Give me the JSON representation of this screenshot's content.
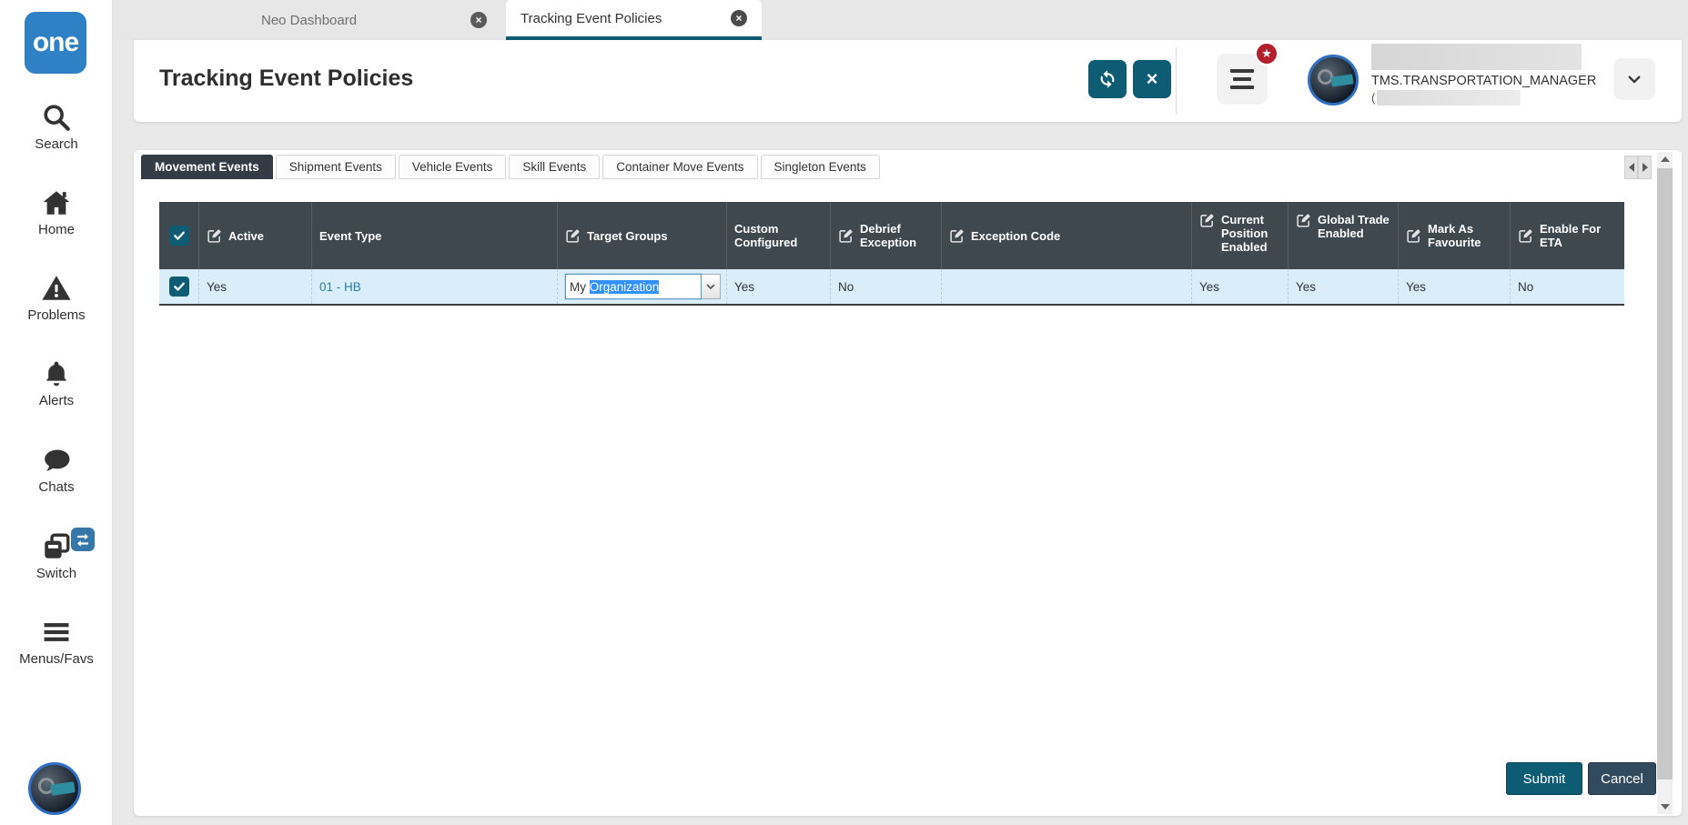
{
  "colors": {
    "teal": "#0d5c74",
    "grid_header": "#3f474f",
    "active_view_tab": "#333b44",
    "row_bg": "#daeef9",
    "link": "#2d7fa3",
    "logo_blue": "#2e81c4",
    "selection_blue": "#3390ff",
    "badge_red": "#b1202c",
    "cancel_btn": "#324a5e"
  },
  "icons": {
    "close_glyph": "×",
    "star_glyph": "★"
  },
  "sidebar": {
    "logo": "one",
    "items": [
      {
        "label": "Search"
      },
      {
        "label": "Home"
      },
      {
        "label": "Problems"
      },
      {
        "label": "Alerts"
      },
      {
        "label": "Chats"
      },
      {
        "label": "Switch"
      },
      {
        "label": "Menus/Favs"
      }
    ]
  },
  "window_tabs": {
    "inactive": "Neo Dashboard",
    "active": "Tracking Event Policies"
  },
  "header": {
    "title": "Tracking Event Policies",
    "user_role": "TMS.TRANSPORTATION_MANAGER",
    "user_paren": "("
  },
  "view_tabs": [
    "Movement Events",
    "Shipment Events",
    "Vehicle Events",
    "Skill Events",
    "Container Move Events",
    "Singleton Events"
  ],
  "active_view_tab": "Movement Events",
  "table": {
    "columns": [
      {
        "label": "Active",
        "editable": true
      },
      {
        "label": "Event Type",
        "editable": false
      },
      {
        "label": "Target Groups",
        "editable": true
      },
      {
        "label": "Custom Configured",
        "editable": false
      },
      {
        "label": "Debrief Exception",
        "editable": true
      },
      {
        "label": "Exception Code",
        "editable": true
      },
      {
        "label": "Current Position Enabled",
        "editable": true
      },
      {
        "label": "Global Trade Enabled",
        "editable": true
      },
      {
        "label": "Mark As Favourite",
        "editable": true
      },
      {
        "label": "Enable For ETA",
        "editable": true
      }
    ],
    "row": {
      "selected": true,
      "active": "Yes",
      "event_type": "01 - HB",
      "target_prefix": "My ",
      "target_selected": "Organization",
      "custom_configured": "Yes",
      "debrief_exception": "No",
      "exception_code": "",
      "current_position_enabled": "Yes",
      "global_trade_enabled": "Yes",
      "mark_as_favourite": "Yes",
      "enable_for_eta": "No"
    }
  },
  "footer": {
    "submit": "Submit",
    "cancel": "Cancel"
  }
}
